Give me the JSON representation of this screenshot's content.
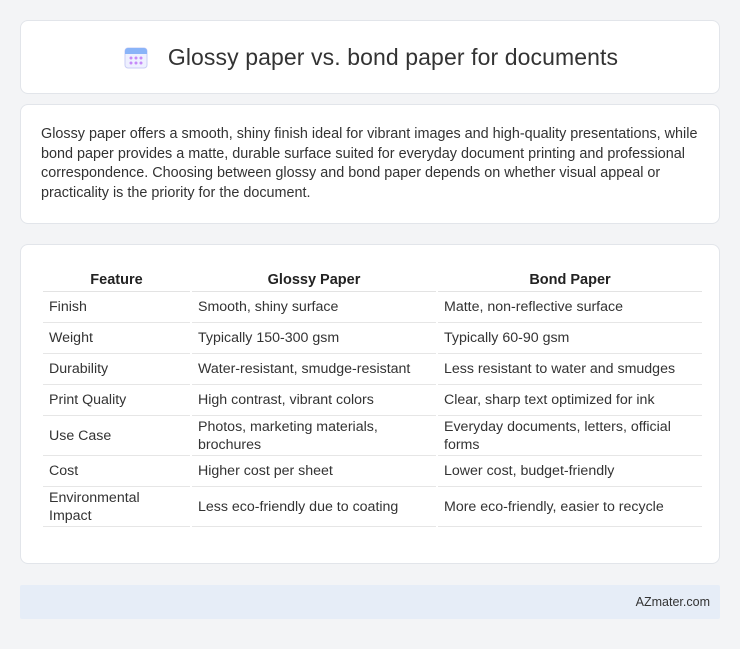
{
  "header": {
    "title": "Glossy paper vs. bond paper for documents",
    "icon": "calendar-icon"
  },
  "intro": {
    "text": "Glossy paper offers a smooth, shiny finish ideal for vibrant images and high-quality presentations, while bond paper provides a matte, durable surface suited for everyday document printing and professional correspondence. Choosing between glossy and bond paper depends on whether visual appeal or practicality is the priority for the document."
  },
  "table": {
    "headers": [
      "Feature",
      "Glossy Paper",
      "Bond Paper"
    ],
    "rows": [
      [
        "Finish",
        "Smooth, shiny surface",
        "Matte, non-reflective surface"
      ],
      [
        "Weight",
        "Typically 150-300 gsm",
        "Typically 60-90 gsm"
      ],
      [
        "Durability",
        "Water-resistant, smudge-resistant",
        "Less resistant to water and smudges"
      ],
      [
        "Print Quality",
        "High contrast, vibrant colors",
        "Clear, sharp text optimized for ink"
      ],
      [
        "Use Case",
        "Photos, marketing materials, brochures",
        "Everyday documents, letters, official forms"
      ],
      [
        "Cost",
        "Higher cost per sheet",
        "Lower cost, budget-friendly"
      ],
      [
        "Environmental Impact",
        "Less eco-friendly due to coating",
        "More eco-friendly, easier to recycle"
      ]
    ]
  },
  "footer": {
    "brand": "AZmater.com"
  },
  "colors": {
    "background": "#f3f4f6",
    "card": "#ffffff",
    "footer_bg": "#e6edf7",
    "icon_accent": "#8ab4f8"
  }
}
